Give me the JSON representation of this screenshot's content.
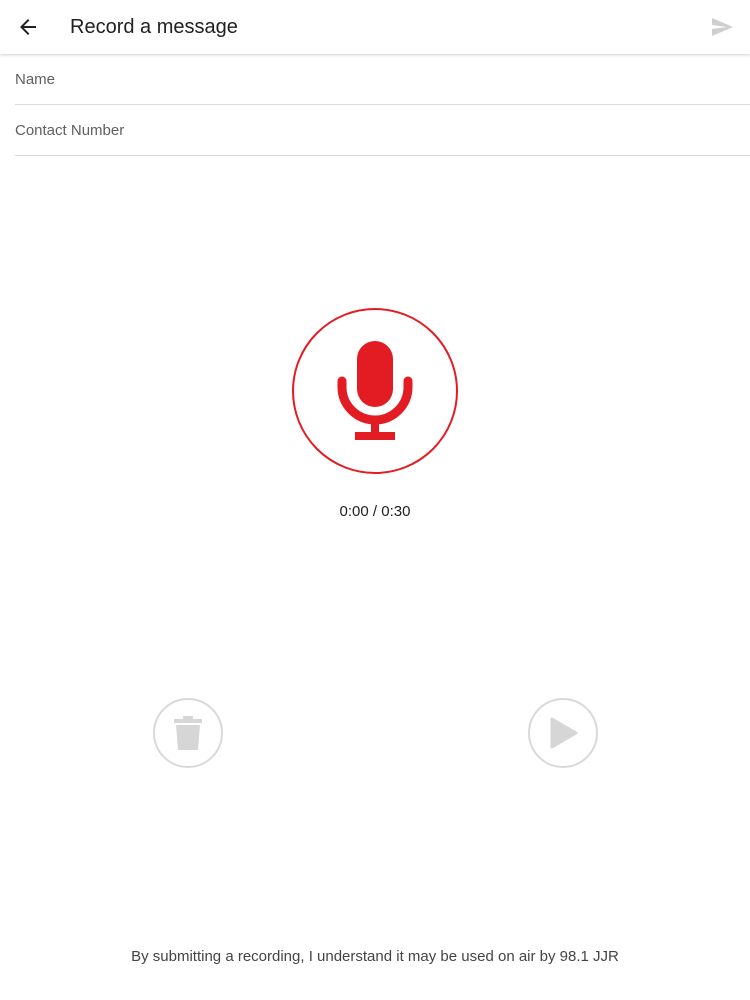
{
  "app_bar": {
    "title": "Record a message",
    "back_icon": "arrow-left-icon",
    "send_icon": "send-icon"
  },
  "form": {
    "name_placeholder": "Name",
    "name_value": "",
    "contact_placeholder": "Contact Number",
    "contact_value": ""
  },
  "recorder": {
    "mic_icon": "microphone-icon",
    "timer": "0:00 / 0:30",
    "accent_color": "#e31b23"
  },
  "controls": {
    "delete_icon": "trash-icon",
    "play_icon": "play-icon",
    "disabled_color": "#d9d9d9"
  },
  "disclaimer": "By submitting a recording, I understand it may be used on air by 98.1 JJR"
}
